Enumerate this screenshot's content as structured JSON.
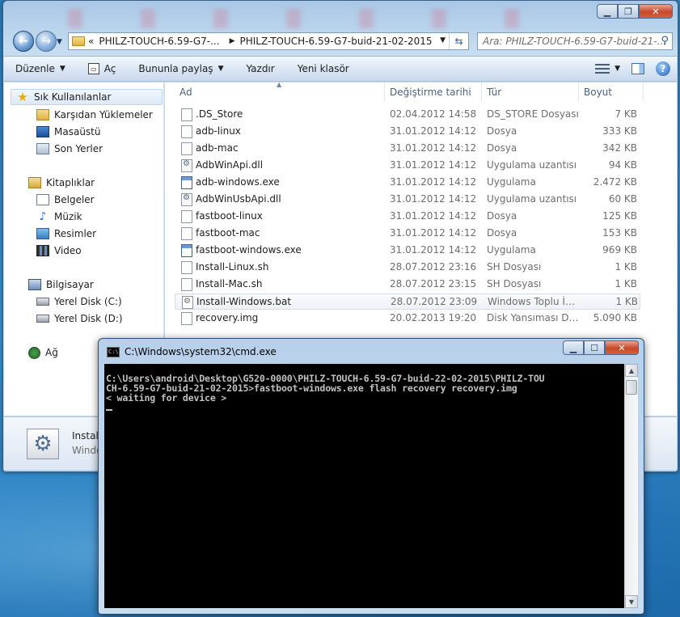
{
  "explorer": {
    "address": {
      "overflow": "«",
      "crumb1": "PHILZ-TOUCH-6.59-G7-...",
      "crumb2": "PHILZ-TOUCH-6.59-G7-buid-21-02-2015"
    },
    "search_placeholder": "Ara: PHILZ-TOUCH-6.59-G7-buid-21-...",
    "toolbar": {
      "organize": "Düzenle",
      "open": "Aç",
      "share": "Bununla paylaş",
      "print": "Yazdır",
      "new_folder": "Yeni klasör"
    },
    "nav": {
      "favorites": "Sık Kullanılanlar",
      "downloads": "Karşıdan Yüklemeler",
      "desktop": "Masaüstü",
      "recent": "Son Yerler",
      "libraries": "Kitaplıklar",
      "documents": "Belgeler",
      "music": "Müzik",
      "pictures": "Resimler",
      "video": "Video",
      "computer": "Bilgisayar",
      "disk_c": "Yerel Disk (C:)",
      "disk_d": "Yerel Disk (D:)",
      "network": "Ağ"
    },
    "columns": {
      "name": "Ad",
      "date": "Değiştirme tarihi",
      "type": "Tür",
      "size": "Boyut"
    },
    "files": [
      {
        "name": ".DS_Store",
        "date": "02.04.2012 14:58",
        "type": "DS_STORE Dosyası",
        "size": "7 KB",
        "icon": "file-icon"
      },
      {
        "name": "adb-linux",
        "date": "31.01.2012 14:12",
        "type": "Dosya",
        "size": "333 KB",
        "icon": "file-icon"
      },
      {
        "name": "adb-mac",
        "date": "31.01.2012 14:12",
        "type": "Dosya",
        "size": "342 KB",
        "icon": "file-icon"
      },
      {
        "name": "AdbWinApi.dll",
        "date": "31.01.2012 14:12",
        "type": "Uygulama uzantısı",
        "size": "94 KB",
        "icon": "dll-icon"
      },
      {
        "name": "adb-windows.exe",
        "date": "31.01.2012 14:12",
        "type": "Uygulama",
        "size": "2.472 KB",
        "icon": "exe-icon"
      },
      {
        "name": "AdbWinUsbApi.dll",
        "date": "31.01.2012 14:12",
        "type": "Uygulama uzantısı",
        "size": "60 KB",
        "icon": "dll-icon"
      },
      {
        "name": "fastboot-linux",
        "date": "31.01.2012 14:12",
        "type": "Dosya",
        "size": "125 KB",
        "icon": "file-icon"
      },
      {
        "name": "fastboot-mac",
        "date": "31.01.2012 14:12",
        "type": "Dosya",
        "size": "153 KB",
        "icon": "file-icon"
      },
      {
        "name": "fastboot-windows.exe",
        "date": "31.01.2012 14:12",
        "type": "Uygulama",
        "size": "969 KB",
        "icon": "exe-icon"
      },
      {
        "name": "Install-Linux.sh",
        "date": "28.07.2012 23:16",
        "type": "SH Dosyası",
        "size": "1 KB",
        "icon": "file-icon"
      },
      {
        "name": "Install-Mac.sh",
        "date": "28.07.2012 23:15",
        "type": "SH Dosyası",
        "size": "1 KB",
        "icon": "file-icon"
      },
      {
        "name": "Install-Windows.bat",
        "date": "28.07.2012 23:09",
        "type": "Windows Toplu İş ...",
        "size": "1 KB",
        "icon": "bat-icon"
      },
      {
        "name": "recovery.img",
        "date": "20.02.2013 19:20",
        "type": "Disk Yansıması Do...",
        "size": "5.090 KB",
        "icon": "file-icon"
      }
    ],
    "details": {
      "name": "Install",
      "type": "Windo"
    }
  },
  "cmd": {
    "title": "C:\\Windows\\system32\\cmd.exe",
    "icon_text": "C:\\",
    "lines": [
      "C:\\Users\\android\\Desktop\\G520-0000\\PHILZ-TOUCH-6.59-G7-buid-22-02-2015\\PHILZ-TOU",
      "CH-6.59-G7-buid-21-02-2015>fastboot-windows.exe flash recovery recovery.img",
      "< waiting for device >"
    ]
  }
}
